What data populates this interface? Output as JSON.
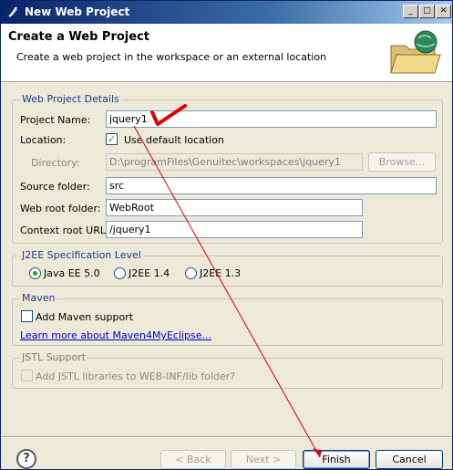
{
  "window": {
    "title": "New Web Project",
    "minimize_glyph": "_",
    "close_glyph": "✕"
  },
  "header": {
    "title": "Create a Web Project",
    "description": "Create a web project in the workspace or an external location",
    "icon": "folder-globe-icon"
  },
  "web_project_details": {
    "group_label": "Web Project Details",
    "project_name_label": "Project Name:",
    "project_name_value": "jquery1",
    "location_label": "Location:",
    "use_default_location_label": "Use default location",
    "use_default_location_checked": true,
    "directory_label": "Directory:",
    "directory_value": "D:\\programFiles\\Genuitec\\workspaces\\jquery1",
    "browse_label": "Browse...",
    "source_folder_label": "Source folder:",
    "source_folder_value": "src",
    "web_root_folder_label": "Web root folder:",
    "web_root_folder_value": "WebRoot",
    "context_root_url_label": "Context root URL:",
    "context_root_url_value": "/jquery1"
  },
  "j2ee": {
    "group_label": "J2EE Specification Level",
    "options": [
      "Java EE 5.0",
      "J2EE 1.4",
      "J2EE 1.3"
    ],
    "selected": "Java EE 5.0"
  },
  "maven": {
    "group_label": "Maven",
    "add_maven_support_label": "Add Maven support",
    "add_maven_support_checked": false,
    "learn_more_link": "Learn more about Maven4MyEclipse..."
  },
  "jstl": {
    "group_label": "JSTL Support",
    "add_jstl_label": "Add JSTL libraries to WEB-INF/lib folder?",
    "add_jstl_checked": false
  },
  "footer": {
    "help_glyph": "?",
    "back_label": "< Back",
    "next_label": "Next >",
    "finish_label": "Finish",
    "cancel_label": "Cancel"
  },
  "colors": {
    "titlebar": "#0a246a",
    "annotation": "#e00000",
    "group_label": "#1f3c88",
    "link": "#0000cc"
  }
}
